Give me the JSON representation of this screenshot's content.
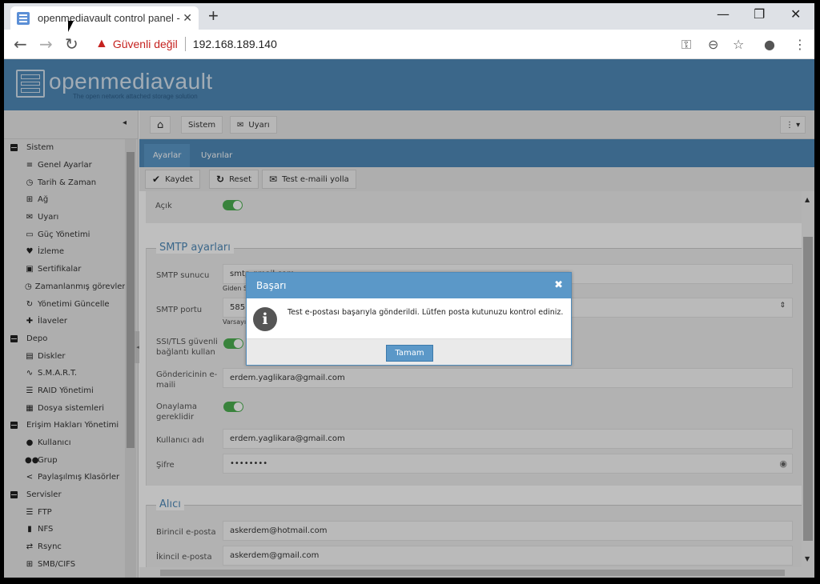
{
  "browser": {
    "tab_title": "openmediavault control panel - c",
    "tab_close": "✕",
    "new_tab": "+",
    "minimize": "—",
    "restore": "❐",
    "close": "✕",
    "security_icon": "warning-icon",
    "security_label": "Güvenli değil",
    "url": "192.168.189.140"
  },
  "header": {
    "logo": "openmediavault",
    "tagline": "The open network attached storage solution"
  },
  "sidebar": {
    "groups": [
      {
        "label": "Sistem",
        "items": [
          {
            "icon": "≡",
            "label": "Genel Ayarlar"
          },
          {
            "icon": "◷",
            "label": "Tarih & Zaman"
          },
          {
            "icon": "⊞",
            "label": "Ağ"
          },
          {
            "icon": "✉",
            "label": "Uyarı"
          },
          {
            "icon": "▭",
            "label": "Güç Yönetimi"
          },
          {
            "icon": "♥",
            "label": "İzleme"
          },
          {
            "icon": "▣",
            "label": "Sertifikalar"
          },
          {
            "icon": "◷",
            "label": "Zamanlanmış görevler"
          },
          {
            "icon": "↻",
            "label": "Yönetimi Güncelle"
          },
          {
            "icon": "✚",
            "label": "İlaveler"
          }
        ]
      },
      {
        "label": "Depo",
        "items": [
          {
            "icon": "▤",
            "label": "Diskler"
          },
          {
            "icon": "∿",
            "label": "S.M.A.R.T."
          },
          {
            "icon": "☰",
            "label": "RAID Yönetimi"
          },
          {
            "icon": "▦",
            "label": "Dosya sistemleri"
          }
        ]
      },
      {
        "label": "Erişim Hakları Yönetimi",
        "items": [
          {
            "icon": "●",
            "label": "Kullanıcı"
          },
          {
            "icon": "●●",
            "label": "Grup"
          },
          {
            "icon": "<",
            "label": "Paylaşılmış Klasörler"
          }
        ]
      },
      {
        "label": "Servisler",
        "items": [
          {
            "icon": "☰",
            "label": "FTP"
          },
          {
            "icon": "▮",
            "label": "NFS"
          },
          {
            "icon": "⇄",
            "label": "Rsync"
          },
          {
            "icon": "⊞",
            "label": "SMB/CIFS"
          }
        ]
      }
    ]
  },
  "breadcrumb": {
    "home": "⌂",
    "sistem": "Sistem",
    "uyari": "Uyarı"
  },
  "tabs": [
    "Ayarlar",
    "Uyarılar"
  ],
  "actions": {
    "save": "Kaydet",
    "reset": "Reset",
    "test": "Test e-maili yolla"
  },
  "form": {
    "enabled_label": "Açık",
    "smtp_legend": "SMTP ayarları",
    "smtp_server_label": "SMTP sunucu",
    "smtp_server_value": "smtp.gmail.com",
    "smtp_server_hint": "Giden S",
    "smtp_port_label": "SMTP portu",
    "smtp_port_value": "585",
    "smtp_port_hint": "Varsayı",
    "ssl_label": "SSI/TLS güvenli bağlantı kullan",
    "sender_label": "Göndericinin e-maili",
    "sender_value": "erdem.yaglikara@gmail.com",
    "auth_label": "Onaylama gereklidir",
    "user_label": "Kullanıcı adı",
    "user_value": "erdem.yaglikara@gmail.com",
    "pass_label": "Şifre",
    "pass_value": "••••••••",
    "recipient_legend": "Alıcı",
    "primary_label": "Birincil e-posta",
    "primary_value": "askerdem@hotmail.com",
    "secondary_label": "İkincil e-posta",
    "secondary_value": "askerdem@gmail.com"
  },
  "dialog": {
    "title": "Başarı",
    "close": "✖",
    "message": "Test e-postası başarıyla gönderildi. Lütfen posta kutunuzu kontrol ediniz.",
    "ok": "Tamam",
    "info": "i"
  }
}
